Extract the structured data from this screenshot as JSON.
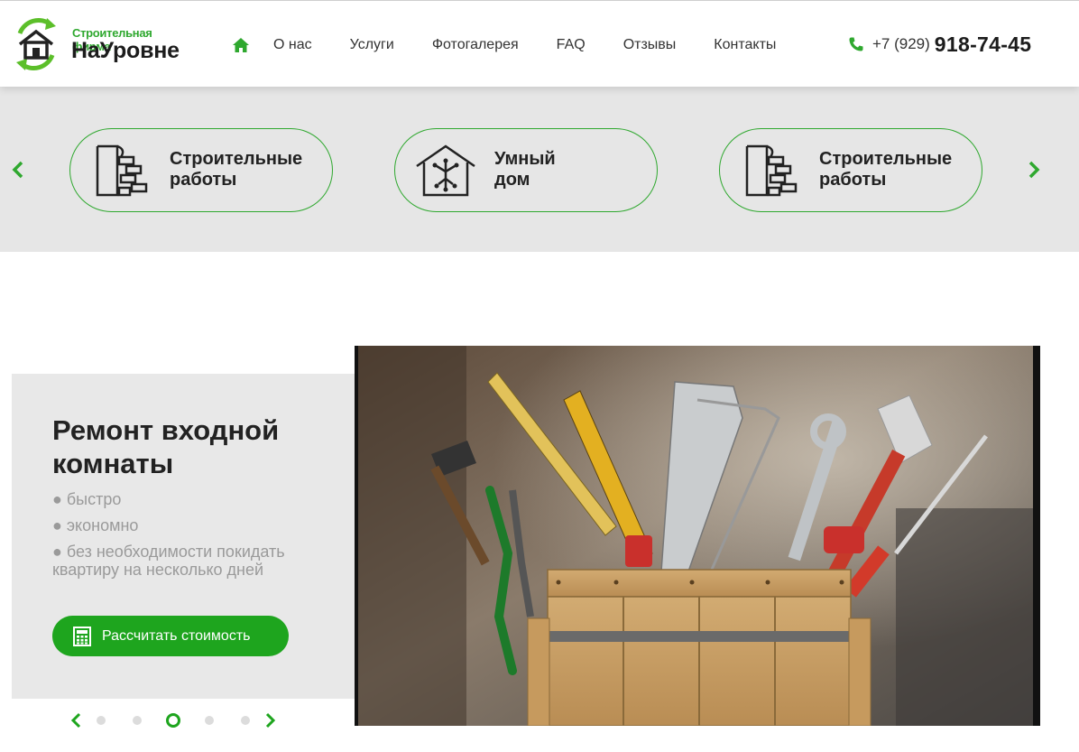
{
  "brand": {
    "tagline": "Строительная фирма",
    "name": "НаУровне",
    "accent_color": "#2fa82f"
  },
  "nav": {
    "home_icon": "home-icon",
    "items": [
      {
        "label": "О нас"
      },
      {
        "label": "Услуги"
      },
      {
        "label": "Фотогалерея"
      },
      {
        "label": "FAQ"
      },
      {
        "label": "Отзывы"
      },
      {
        "label": "Контакты"
      }
    ]
  },
  "phone": {
    "icon": "phone-icon",
    "prefix": "+7 (929)",
    "number": "918-74-45"
  },
  "services": {
    "prev_icon": "chevron-left-icon",
    "next_icon": "chevron-right-icon",
    "cards": [
      {
        "line1": "Строительные",
        "line2": "работы",
        "icon": "brick-wall-icon"
      },
      {
        "line1": "Умный",
        "line2": "дом",
        "icon": "smart-home-icon"
      },
      {
        "line1": "Строительные",
        "line2": "работы",
        "icon": "brick-wall-icon"
      }
    ]
  },
  "hero": {
    "title_line1": "Ремонт входной",
    "title_line2": "комнаты",
    "bullets": [
      "● быстро",
      "● экономно",
      "● без необходимости покидать квартиру на несколько дней"
    ],
    "cta_label": "Рассчитать стоимость",
    "cta_icon": "calculator-icon",
    "image": "toolbox-with-tools-photo"
  },
  "slider": {
    "total": 5,
    "active_index": 3,
    "prev_icon": "chevron-left-icon",
    "next_icon": "chevron-right-icon"
  }
}
